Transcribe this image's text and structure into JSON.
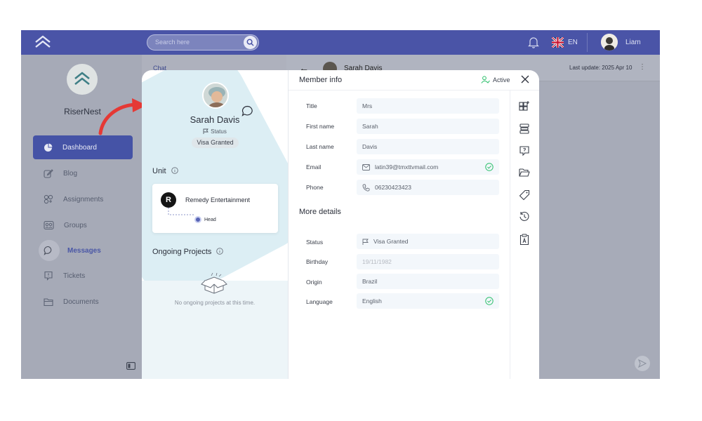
{
  "topbar": {
    "search_placeholder": "Search here",
    "language": "EN",
    "user_name": "Liam"
  },
  "sidebar": {
    "brand": "RiserNest",
    "items": [
      {
        "label": "Dashboard",
        "icon": "pie-chart-icon"
      },
      {
        "label": "Blog",
        "icon": "edit-icon"
      },
      {
        "label": "Assignments",
        "icon": "assignments-icon"
      },
      {
        "label": "Groups",
        "icon": "groups-icon"
      },
      {
        "label": "Messages",
        "icon": "message-icon"
      },
      {
        "label": "Tickets",
        "icon": "ticket-icon"
      },
      {
        "label": "Documents",
        "icon": "folder-icon"
      }
    ]
  },
  "chat": {
    "list_title": "Chat",
    "conversation_name": "Sarah Davis",
    "last_update": "Last update: 2025 Apr 10"
  },
  "profile": {
    "name": "Sarah Davis",
    "status_label": "Status",
    "status_badge": "Visa Granted",
    "unit_title": "Unit",
    "unit_name": "Remedy Entertainment",
    "unit_logo": "R",
    "unit_role": "Head",
    "projects_title": "Ongoing Projects",
    "projects_empty": "No ongoing projects at this time."
  },
  "member_info": {
    "title": "Member info",
    "active_label": "Active",
    "fields": [
      {
        "label": "Title",
        "value": "Mrs"
      },
      {
        "label": "First name",
        "value": "Sarah"
      },
      {
        "label": "Last name",
        "value": "Davis"
      },
      {
        "label": "Email",
        "value": "latin39@tmxttvmail.com"
      },
      {
        "label": "Phone",
        "value": "06230423423"
      }
    ],
    "more_title": "More details",
    "more_fields": [
      {
        "label": "Status",
        "value": "Visa Granted"
      },
      {
        "label": "Birthday",
        "value": "19/11/1982"
      },
      {
        "label": "Origin",
        "value": "Brazil"
      },
      {
        "label": "Language",
        "value": "English"
      }
    ]
  },
  "colors": {
    "primary": "#4553a6",
    "success": "#2bbf6a",
    "annotation_arrow": "#e53935"
  }
}
